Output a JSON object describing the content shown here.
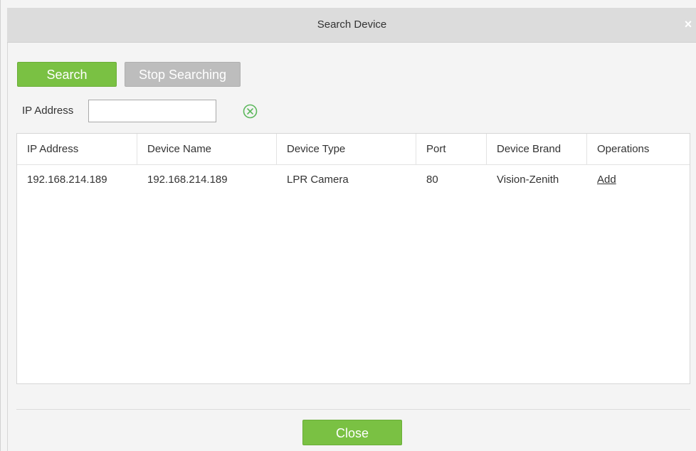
{
  "dialog": {
    "title": "Search Device",
    "close_glyph": "×"
  },
  "toolbar": {
    "search_label": "Search",
    "stop_label": "Stop Searching"
  },
  "filter": {
    "ip_label": "IP Address",
    "ip_value": "",
    "ip_placeholder": "",
    "clear_icon": "clear-circle-x-icon"
  },
  "table": {
    "columns": [
      "IP Address",
      "Device Name",
      "Device Type",
      "Port",
      "Device Brand",
      "Operations"
    ],
    "rows": [
      {
        "ip": "192.168.214.189",
        "name": "192.168.214.189",
        "type": "LPR Camera",
        "port": "80",
        "brand": "Vision-Zenith",
        "operation": "Add"
      }
    ]
  },
  "footer": {
    "close_label": "Close"
  },
  "colors": {
    "primary_green": "#7ac143",
    "disabled_gray": "#bdbdbd",
    "titlebar_gray": "#dcdcdc",
    "clear_icon_green": "#5cb85c"
  }
}
